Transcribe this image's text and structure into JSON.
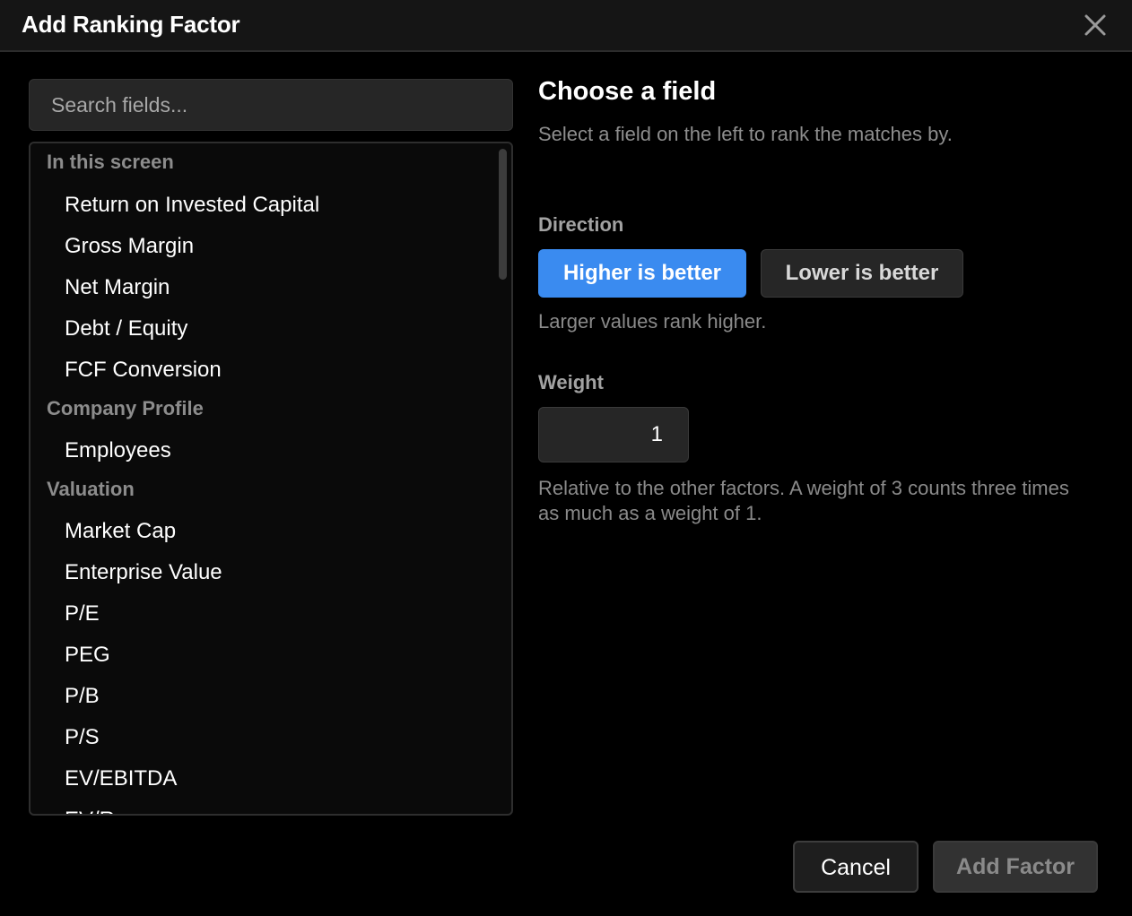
{
  "dialog": {
    "title": "Add Ranking Factor"
  },
  "search": {
    "placeholder": "Search fields...",
    "value": ""
  },
  "field_list": {
    "groups": [
      {
        "label": "In this screen",
        "items": [
          "Return on Invested Capital",
          "Gross Margin",
          "Net Margin",
          "Debt / Equity",
          "FCF Conversion"
        ]
      },
      {
        "label": "Company Profile",
        "items": [
          "Employees"
        ]
      },
      {
        "label": "Valuation",
        "items": [
          "Market Cap",
          "Enterprise Value",
          "P/E",
          "PEG",
          "P/B",
          "P/S",
          "EV/EBITDA",
          "EV/Revenue"
        ]
      }
    ]
  },
  "detail": {
    "heading": "Choose a field",
    "subtitle": "Select a field on the left to rank the matches by.",
    "direction": {
      "label": "Direction",
      "higher_label": "Higher is better",
      "lower_label": "Lower is better",
      "selected": "higher",
      "help": "Larger values rank higher."
    },
    "weight": {
      "label": "Weight",
      "value": "1",
      "help": "Relative to the other factors. A weight of 3 counts three times as much as a weight of 1."
    }
  },
  "footer": {
    "cancel_label": "Cancel",
    "add_label": "Add Factor"
  },
  "colors": {
    "accent": "#3a8bf0",
    "background": "#000000",
    "panel": "#262626"
  }
}
